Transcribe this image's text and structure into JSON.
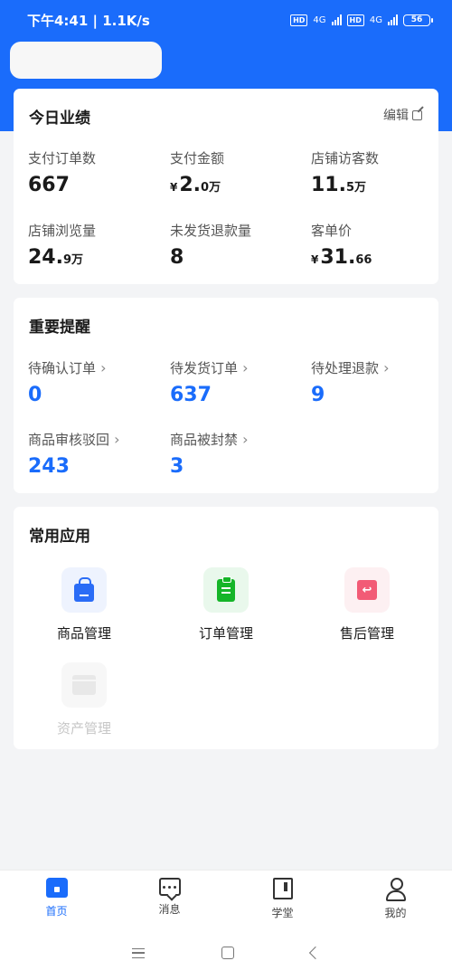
{
  "status_bar": {
    "time": "下午4:41 | 1.1K/s",
    "network": "4G",
    "hd": "HD",
    "battery": "56"
  },
  "performance": {
    "title": "今日业绩",
    "edit_label": "编辑",
    "metrics": [
      {
        "label": "支付订单数",
        "value": "667"
      },
      {
        "label": "支付金额",
        "currency": "¥",
        "value": "2.",
        "value_small": "0万"
      },
      {
        "label": "店铺访客数",
        "value": "11.",
        "value_small": "5万"
      },
      {
        "label": "店铺浏览量",
        "value": "24.",
        "value_small": "9万"
      },
      {
        "label": "未发货退款量",
        "value": "8"
      },
      {
        "label": "客单价",
        "currency": "¥",
        "value": "31.",
        "value_small": "66"
      }
    ]
  },
  "alerts": {
    "title": "重要提醒",
    "items": [
      {
        "label": "待确认订单",
        "value": "0"
      },
      {
        "label": "待发货订单",
        "value": "637"
      },
      {
        "label": "待处理退款",
        "value": "9"
      },
      {
        "label": "商品审核驳回",
        "value": "243"
      },
      {
        "label": "商品被封禁",
        "value": "3"
      }
    ]
  },
  "apps": {
    "title": "常用应用",
    "items": [
      {
        "label": "商品管理",
        "icon": "shopping-bag-icon",
        "color": "#2a6cf6"
      },
      {
        "label": "订单管理",
        "icon": "clipboard-icon",
        "color": "#15b528"
      },
      {
        "label": "售后管理",
        "icon": "return-icon",
        "color": "#f25b76"
      },
      {
        "label": "资产管理",
        "icon": "wallet-icon",
        "color": "#d7d7d7"
      }
    ]
  },
  "tabbar": {
    "items": [
      {
        "label": "首页",
        "icon": "home-icon",
        "active": true
      },
      {
        "label": "消息",
        "icon": "message-icon",
        "active": false
      },
      {
        "label": "学堂",
        "icon": "book-icon",
        "active": false
      },
      {
        "label": "我的",
        "icon": "user-icon",
        "active": false
      }
    ]
  },
  "colors": {
    "brand_blue": "#1a6cfb",
    "page_bg": "#f3f4f6"
  }
}
